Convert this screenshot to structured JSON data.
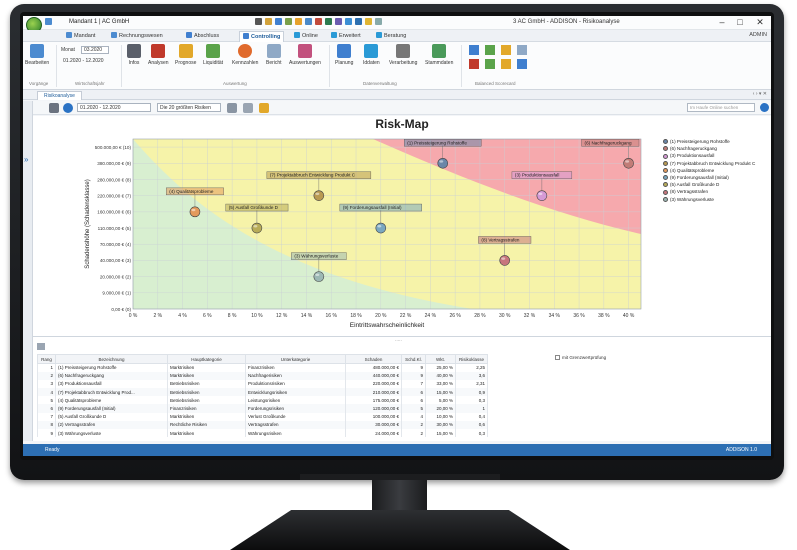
{
  "titlebar": {
    "mandant": "Mandant 1  |  AC GmbH",
    "window_title": "3 AC GmbH - ADDISON - Risikoanalyse",
    "min": "–",
    "max": "□",
    "close": "✕"
  },
  "menu": {
    "tabs": [
      "Mandant",
      "Rechnungswesen",
      "Abschluss",
      "Controlling",
      "Online",
      "Erweitert",
      "Beratung"
    ],
    "active": "Controlling",
    "admin": "ADMIN"
  },
  "ribbon": {
    "bearbeiten": "Bearbeiten",
    "monat_label": "Monat",
    "monat_value": "03.2020",
    "zeitraum": "01.2020 - 12.2020",
    "buttons": [
      "Infos",
      "Analysen",
      "Prognose",
      "Liquidität",
      "Kennzahlen",
      "Bericht",
      "Auswertungen",
      "Planung",
      "Iddaten",
      "Verarbeitung",
      "Stammdaten"
    ],
    "groups": {
      "vorgaenge": "Vorgänge",
      "wirtschaftsjahr": "Wirtschaftsjahr",
      "auswertung": "Auswertung",
      "datenverwaltung": "Datenverwaltung",
      "balanced": "Balanced Scorecard"
    }
  },
  "doc_tab": "Risikoanalyse",
  "toolbar": {
    "period": "01.2020 - 12.2020",
    "filter": "Die 20 größten Risiken",
    "search_placeholder": "Im Haufe Online suchen"
  },
  "chart_data": {
    "type": "scatter",
    "title": "Risk-Map",
    "xlabel": "Eintrittswahrscheinlichkeit",
    "ylabel": "Schadenshöhe (Schadensklasse)",
    "x_ticks": [
      "0 %",
      "2 %",
      "4 %",
      "6 %",
      "8 %",
      "10 %",
      "12 %",
      "14 %",
      "16 %",
      "18 %",
      "20 %",
      "22 %",
      "24 %",
      "26 %",
      "28 %",
      "30 %",
      "32 %",
      "34 %",
      "36 %",
      "38 %",
      "40 %"
    ],
    "y_ticks": [
      "0,00 € (0)",
      "9.000,00 € (1)",
      "20.000,00 € (2)",
      "40.000,00 € (3)",
      "70.000,00 € (4)",
      "110.000,00 € (5)",
      "160.000,00 € (6)",
      "220.000,00 € (7)",
      "280.000,00 € (8)",
      "380.000,00 € (9)",
      "500.000,00 € (10)"
    ],
    "xlim": [
      0,
      41
    ],
    "ylim": [
      0,
      10.5
    ],
    "points": [
      {
        "label": "(1) Preissteigerung Rohstoffe",
        "x": 25,
        "y": 9,
        "color": "#6b86a8"
      },
      {
        "label": "(6) Nachfrageruckgang",
        "x": 40,
        "y": 9,
        "color": "#c27c77"
      },
      {
        "label": "(3) Produktionsausfall",
        "x": 33,
        "y": 7,
        "color": "#d59ad6"
      },
      {
        "label": "(4) Qualitätsprobleme",
        "x": 5,
        "y": 6,
        "color": "#e39a5c"
      },
      {
        "label": "(7) Projektabbruch Entwicklung Produkt C",
        "x": 15,
        "y": 7,
        "color": "#b99a52"
      },
      {
        "label": "(9) Forderungsausfall (Initial)",
        "x": 20,
        "y": 5,
        "color": "#7aa7c0"
      },
      {
        "label": "(5) Ausfall Großkunde D",
        "x": 10,
        "y": 5,
        "color": "#b8ac58"
      },
      {
        "label": "(8) Vertragsstrafen",
        "x": 30,
        "y": 3,
        "color": "#c7767d"
      },
      {
        "label": "(3) Währungsverluste",
        "x": 15,
        "y": 2,
        "color": "#9cb8b4"
      }
    ],
    "zones": {
      "green": "#d8efd0",
      "yellow": "#f6f3a9",
      "red": "#f6a9ad"
    },
    "legend": [
      "(1) Preissteigerung Rohstoffe",
      "(6) Nachfrageruckgang",
      "(3) Produktionsausfall",
      "(7) Projektabbruch Entwicklung Produkt C",
      "(4) Qualitätsprobleme",
      "(9) Forderungsausfall (Initial)",
      "(5) Ausfall Großkunde D",
      "(8) Vertragsstrafen",
      "(3) Währungsverluste"
    ]
  },
  "table": {
    "columns": [
      "Rang",
      "Bezeichnung",
      "Hauptkategorie",
      "Unterkategorie",
      "Schaden",
      "Schd.Kl.",
      "Wkt.",
      "Risikoklasse"
    ],
    "rows": [
      [
        "1",
        "(1) Preissteigerung Rohstoffe",
        "Marktrisiken",
        "Finanzrisiken",
        "480.000,00 €",
        "9",
        "25,00 %",
        "2,25"
      ],
      [
        "2",
        "(6) Nachfrageruckgang",
        "Marktrisiken",
        "Nachfragerisiken",
        "440.000,00 €",
        "9",
        "40,00 %",
        "3,6"
      ],
      [
        "3",
        "(3) Produktionsausfall",
        "Betriebsrisiken",
        "Produktionsrisiken",
        "220.000,00 €",
        "7",
        "33,00 %",
        "2,31"
      ],
      [
        "4",
        "(7) Projektabbruch Entwicklung Prod...",
        "Betriebsrisiken",
        "Entwicklungsrisiken",
        "210.000,00 €",
        "6",
        "15,00 %",
        "0,9"
      ],
      [
        "5",
        "(4) Qualitätsprobleme",
        "Betriebsrisiken",
        "Leistungsrisiken",
        "175.000,00 €",
        "6",
        "5,00 %",
        "0,3"
      ],
      [
        "6",
        "(9) Forderungsausfall (Initial)",
        "Finanzrisiken",
        "Forderungsrisiken",
        "120.000,00 €",
        "5",
        "20,00 %",
        "1"
      ],
      [
        "7",
        "(5) Ausfall Großkunde D",
        "Marktrisiken",
        "Verlust Großkunde",
        "100.000,00 €",
        "4",
        "10,00 %",
        "0,4"
      ],
      [
        "8",
        "(2) Vertragsstrafen",
        "Rechtliche Risiken",
        "Vertragsstrafen",
        "30.000,00 €",
        "2",
        "30,00 %",
        "0,6"
      ],
      [
        "9",
        "(3) Währungsverluste",
        "Marktrisiken",
        "Währungsrisiken",
        "24.000,00 €",
        "2",
        "15,00 %",
        "0,3"
      ]
    ],
    "checkbox_label": "mit Grenzwertprüfung",
    "grip": "....."
  },
  "status": {
    "left": "Ready",
    "right": "ADDISON 1.0"
  }
}
